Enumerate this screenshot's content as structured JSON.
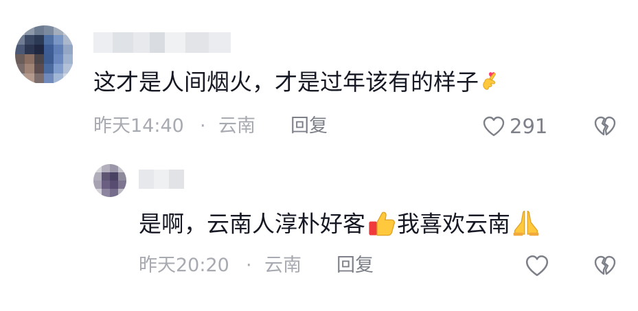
{
  "comments": [
    {
      "text": "这才是人间烟火，才是过年该有的样子",
      "emoji": "heart-fingers-emoji",
      "time": "昨天14:40",
      "separator": "·",
      "location": "云南",
      "reply_label": "回复",
      "like_count": "291",
      "like_icon": "heart-outline-icon",
      "dislike_icon": "broken-heart-icon"
    },
    {
      "text_part1": "是啊，云南人淳朴好客",
      "emoji1": "thumbs-up-emoji",
      "text_part2": "我喜欢云南",
      "emoji2": "praying-hands-emoji",
      "time": "昨天20:20",
      "separator": "·",
      "location": "云南",
      "reply_label": "回复",
      "like_icon": "heart-outline-icon",
      "dislike_icon": "broken-heart-icon"
    }
  ],
  "colors": {
    "text": "#161823",
    "meta": "#a8aab1",
    "icon": "#7d8088",
    "background": "#ffffff"
  }
}
